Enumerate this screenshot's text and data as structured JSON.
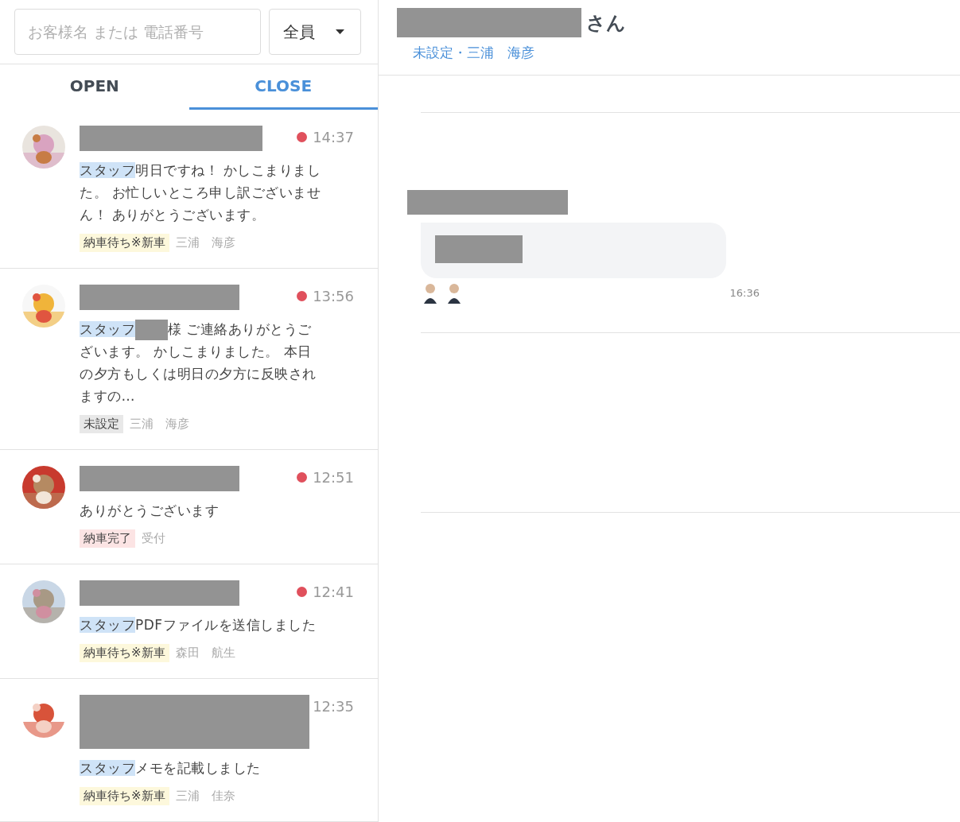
{
  "search": {
    "placeholder": "お客様名 または 電話番号"
  },
  "filter": {
    "value": "全員"
  },
  "tabs": [
    {
      "label": "OPEN",
      "selected": false
    },
    {
      "label": "CLOSE",
      "selected": true
    }
  ],
  "conversations": [
    {
      "time": "14:37",
      "unread": true,
      "staff_label": "スタッフ",
      "redacted_lead": false,
      "message": "明日ですね！ かしこまりました。 お忙しいところ申し訳ございません！ ありがとうございます。",
      "tag": {
        "label": "納車待ち※新車",
        "color": "#fdf8dc"
      },
      "assignee": "三浦　海彦"
    },
    {
      "time": "13:56",
      "unread": true,
      "staff_label": "スタッフ",
      "redacted_lead": true,
      "message": "様 ご連絡ありがとうございます。 かしこまりました。 本日の夕方もしくは明日の夕方に反映されますの…",
      "tag": {
        "label": "未設定",
        "color": "#e8e8e8"
      },
      "assignee": "三浦　海彦"
    },
    {
      "time": "12:51",
      "unread": true,
      "redacted_lead": false,
      "message": "ありがとうございます",
      "tag": {
        "label": "納車完了",
        "color": "#fce4e4"
      },
      "assignee": "受付"
    },
    {
      "time": "12:41",
      "unread": true,
      "staff_label": "スタッフ",
      "redacted_lead": false,
      "message": "PDFファイルを送信しました",
      "tag": {
        "label": "納車待ち※新車",
        "color": "#fdf8dc"
      },
      "assignee": "森田　航生"
    },
    {
      "time": "12:35",
      "unread": false,
      "staff_label": "スタッフ",
      "redacted_lead": false,
      "message": "メモを記載しました",
      "tag": {
        "label": "納車待ち※新車",
        "color": "#fdf8dc"
      },
      "assignee": "三浦　佳奈"
    }
  ],
  "chat": {
    "title_suffix": "さん",
    "subtitle": "未設定・三浦　海彦",
    "message_time": "16:36"
  }
}
